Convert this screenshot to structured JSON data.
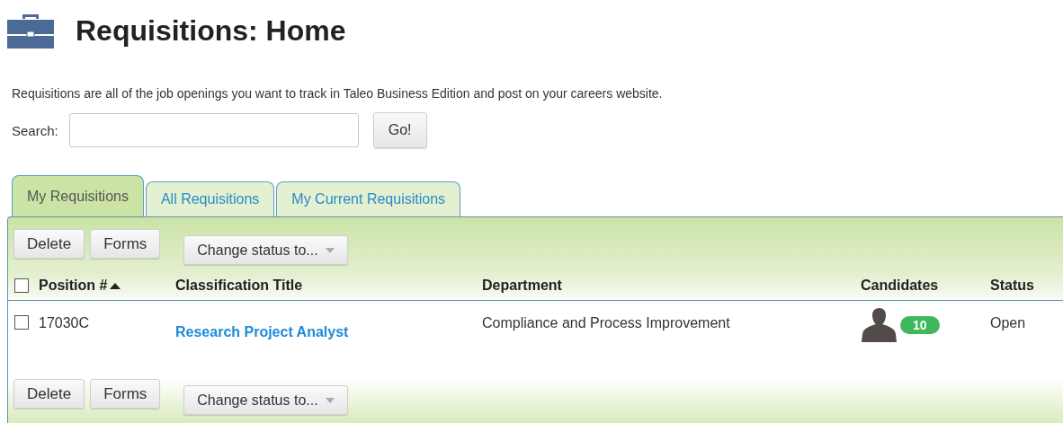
{
  "page": {
    "title": "Requisitions: Home",
    "description": "Requisitions are all of the job openings you want to track in Taleo Business Edition and post on your careers website."
  },
  "search": {
    "label": "Search:",
    "button": "Go!"
  },
  "tabs": [
    {
      "label": "My Requisitions",
      "selected": true
    },
    {
      "label": "All Requisitions",
      "selected": false
    },
    {
      "label": "My Current Requisitions",
      "selected": false
    }
  ],
  "toolbar_top": {
    "buttons": [
      "Delete",
      "Forms"
    ],
    "dropdown": "Change status to..."
  },
  "table": {
    "select_all": {
      "checked": false
    },
    "columns": [
      {
        "label": "Position #",
        "sorted": true
      },
      {
        "label": "Classification Title",
        "sorted": false
      },
      {
        "label": "Department",
        "sorted": false
      },
      {
        "label": "Candidates",
        "sorted": false
      },
      {
        "label": "Status",
        "sorted": false
      }
    ],
    "rows": [
      {
        "checked": false,
        "position": "17030C",
        "title": "Research Project Analyst",
        "department": "Compliance and Process Improvement",
        "candidates": "10",
        "status": "Open"
      }
    ]
  },
  "toolbar_bottom": {
    "buttons": [
      "Delete",
      "Forms"
    ],
    "dropdown": "Change status to..."
  }
}
